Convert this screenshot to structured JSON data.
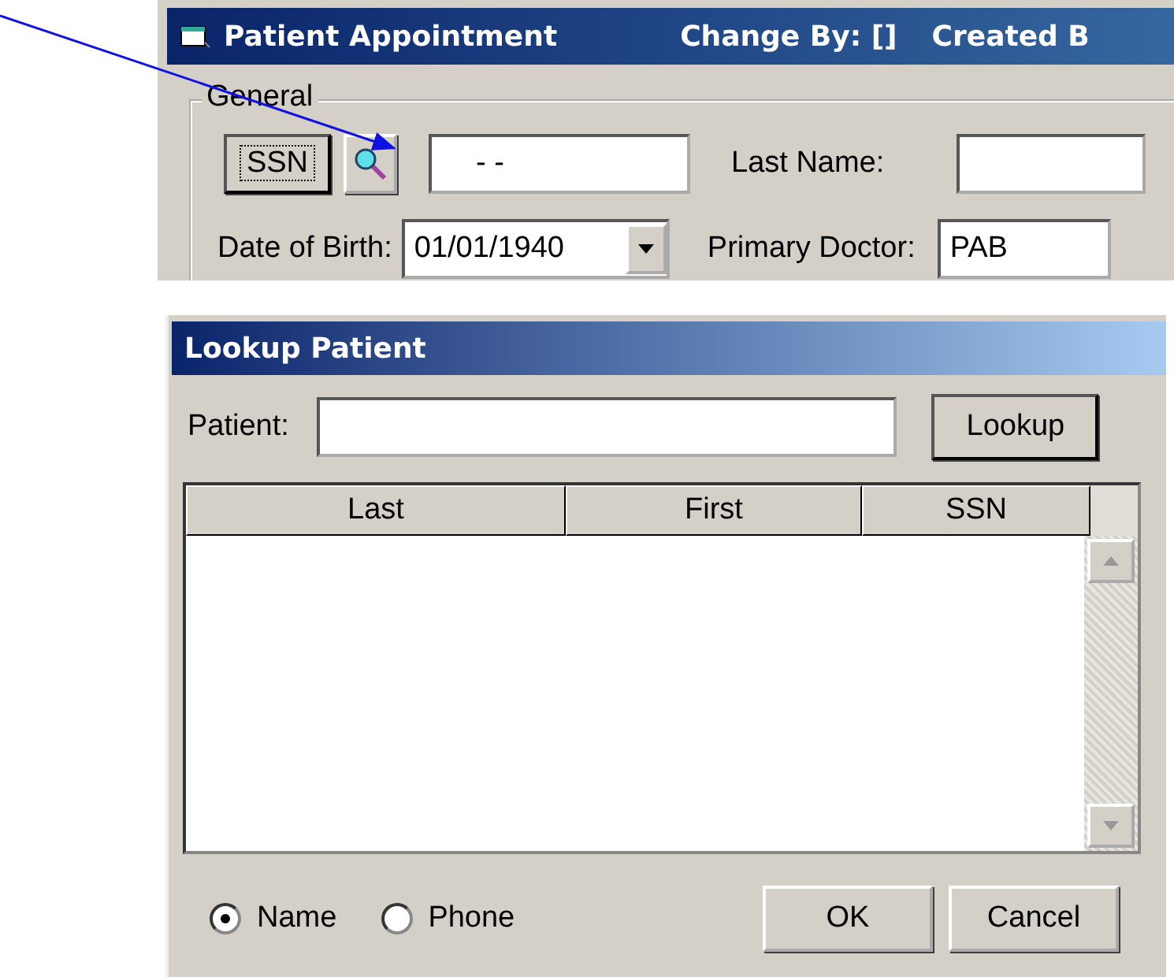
{
  "appointment_window": {
    "title": "Patient Appointment",
    "change_by": "Change By: []",
    "created_by": "Created B",
    "group": {
      "label": "General",
      "ssn_button": "SSN",
      "ssn_value": "- -",
      "last_name_label": "Last Name:",
      "dob_label": "Date of Birth:",
      "dob_value": "01/01/1940",
      "doctor_label": "Primary Doctor:",
      "doctor_value": "PAB"
    }
  },
  "lookup_dialog": {
    "title": "Lookup Patient",
    "patient_label": "Patient:",
    "lookup_button": "Lookup",
    "columns": [
      "Last",
      "First",
      "SSN"
    ],
    "search_by": [
      {
        "label": "Name",
        "selected": true
      },
      {
        "label": "Phone",
        "selected": false
      }
    ],
    "buttons": [
      "OK",
      "Cancel"
    ]
  }
}
